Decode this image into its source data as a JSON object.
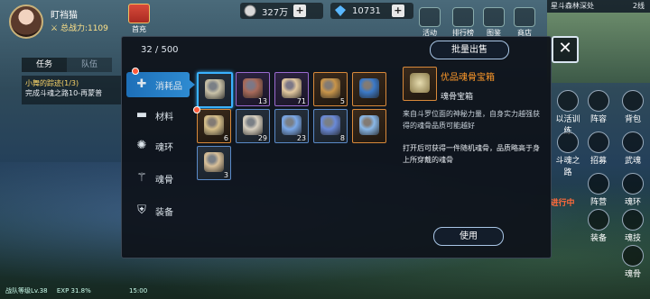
{
  "player": {
    "name": "盯裆猫",
    "power_label": "总战力:1109",
    "gift_label": "首充"
  },
  "currency": {
    "silver": "327万",
    "diamond": "10731"
  },
  "top_menu": [
    "活动",
    "排行榜",
    "图鉴",
    "商店"
  ],
  "map": {
    "location": "星斗森林深处",
    "line": "2线"
  },
  "left_tabs": [
    "任务",
    "队伍"
  ],
  "quest": {
    "title": "小舞的踪迹(1/3)",
    "desc": "完成斗魂之路10-再蒙普"
  },
  "right_buttons": [
    "以活训练",
    "阵容",
    "背包",
    "斗魂之路",
    "招募",
    "武魂",
    "阵营",
    "魂环",
    "装备",
    "魂技",
    "魂骨",
    "进行中"
  ],
  "bottom": {
    "team_level": "战队等级Lv.38",
    "exp": "EXP 31.8%",
    "time": "15:00"
  },
  "inventory": {
    "capacity": "32 / 500",
    "bulk_sell": "批量出售",
    "close": "✕",
    "categories": [
      {
        "label": "消耗品",
        "icon": "potion-icon"
      },
      {
        "label": "材料",
        "icon": "anvil-icon"
      },
      {
        "label": "魂环",
        "icon": "ring-icon"
      },
      {
        "label": "魂骨",
        "icon": "bone-icon"
      },
      {
        "label": "装备",
        "icon": "armor-icon"
      }
    ],
    "items": [
      {
        "qty": "",
        "rarity": "blue",
        "tint": "#c9c2a8"
      },
      {
        "qty": "13",
        "rarity": "purple",
        "tint": "#a86a5a"
      },
      {
        "qty": "71",
        "rarity": "purple",
        "tint": "#e3c9a0"
      },
      {
        "qty": "5",
        "rarity": "orange",
        "tint": "#c9954a"
      },
      {
        "qty": "",
        "rarity": "orange",
        "tint": "#3c7ac8"
      },
      {
        "qty": "6",
        "rarity": "orange",
        "tint": "#d8c08a"
      },
      {
        "qty": "29",
        "rarity": "blue",
        "tint": "#d8d0c0"
      },
      {
        "qty": "23",
        "rarity": "blue",
        "tint": "#7aa8e8"
      },
      {
        "qty": "8",
        "rarity": "blue",
        "tint": "#6a8ad8"
      },
      {
        "qty": "",
        "rarity": "orange",
        "tint": "#8ab8e8"
      },
      {
        "qty": "3",
        "rarity": "blue",
        "tint": "#d8c09a"
      }
    ],
    "detail": {
      "name": "优品魂骨宝箱",
      "type": "魂骨宝箱",
      "desc": "来自斗罗位面的神秘力量，自身实力越强获得的魂骨品质可能越好",
      "effect": "打开后可获得一件随机魂骨，品质略高于身上所穿戴的魂骨",
      "use": "使用"
    }
  }
}
